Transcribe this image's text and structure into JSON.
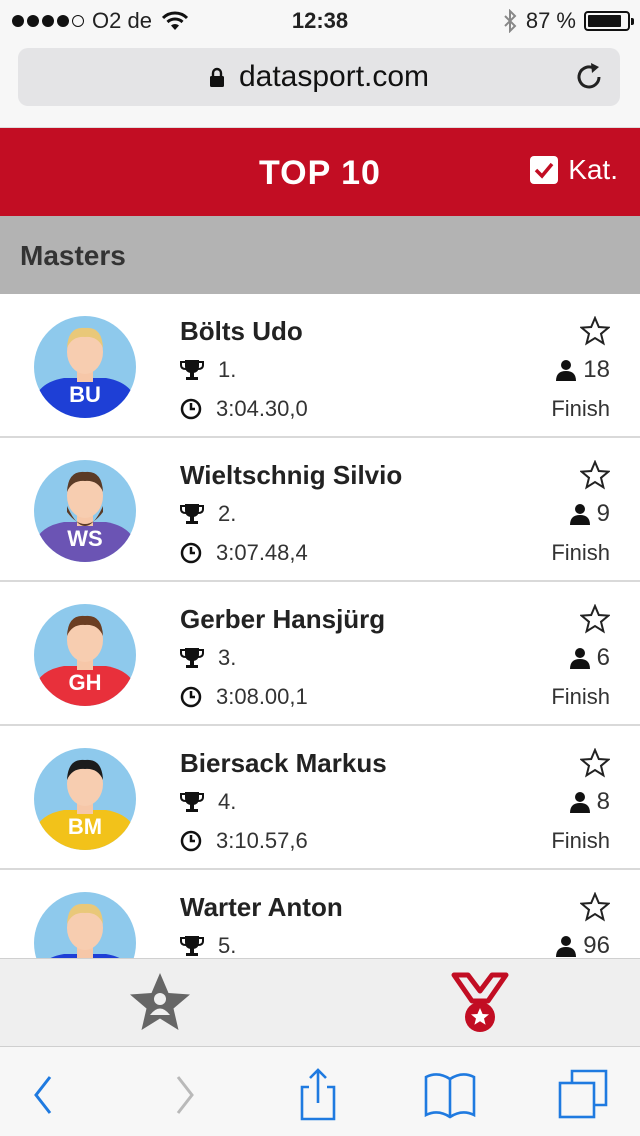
{
  "status_bar": {
    "carrier": "O2 de",
    "time": "12:38",
    "battery": "87 %",
    "battery_level": 0.87
  },
  "browser": {
    "url": "datasport.com"
  },
  "header": {
    "title": "TOP 10",
    "category_label": "Kat."
  },
  "section": {
    "label": "Masters"
  },
  "athletes": [
    {
      "name": "Bölts Udo",
      "initials": "BU",
      "rank": "1.",
      "time": "3:04.30,0",
      "bib": "18",
      "status": "Finish",
      "jersey_color": "#1e3fd6",
      "hair_color": "#e9c879",
      "beard": false
    },
    {
      "name": "Wieltschnig Silvio",
      "initials": "WS",
      "rank": "2.",
      "time": "3:07.48,4",
      "bib": "9",
      "status": "Finish",
      "jersey_color": "#6b54b4",
      "hair_color": "#5b3b26",
      "beard": true
    },
    {
      "name": "Gerber Hansjürg",
      "initials": "GH",
      "rank": "3.",
      "time": "3:08.00,1",
      "bib": "6",
      "status": "Finish",
      "jersey_color": "#e8303b",
      "hair_color": "#6b3e22",
      "beard": false
    },
    {
      "name": "Biersack Markus",
      "initials": "BM",
      "rank": "4.",
      "time": "3:10.57,6",
      "bib": "8",
      "status": "Finish",
      "jersey_color": "#f2c21a",
      "hair_color": "#1c1c1c",
      "beard": false
    },
    {
      "name": "Warter Anton",
      "initials": "",
      "rank": "5.",
      "time": "",
      "bib": "96",
      "status": "",
      "jersey_color": "#1e3fd6",
      "hair_color": "#e9c879",
      "beard": false
    }
  ],
  "colors": {
    "accent": "#c20d23",
    "section_bg": "#b3b3b3",
    "ios_blue": "#1f7ae0",
    "sky": "#8ec9ec"
  },
  "icons": [
    "wifi-icon",
    "bluetooth-icon",
    "lock-icon",
    "reload-icon",
    "checkbox-icon",
    "trophy-icon",
    "clock-icon",
    "star-icon",
    "person-icon",
    "favorites-tab-icon",
    "medal-tab-icon",
    "back-icon",
    "forward-icon",
    "share-icon",
    "bookmarks-icon",
    "tabs-icon"
  ]
}
